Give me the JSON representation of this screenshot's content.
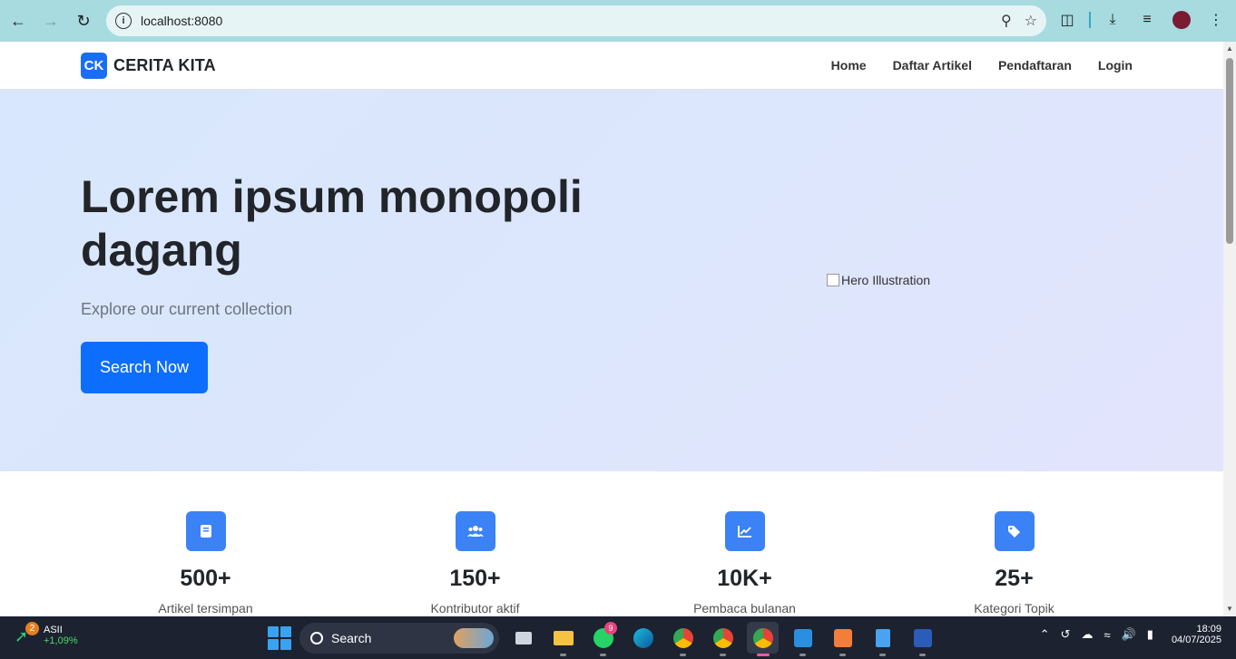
{
  "browser": {
    "url": "localhost:8080"
  },
  "site": {
    "brand_logo": "CK",
    "brand_name": "CERITA KITA",
    "menu": [
      {
        "label": "Home"
      },
      {
        "label": "Daftar Artikel"
      },
      {
        "label": "Pendaftaran"
      },
      {
        "label": "Login"
      }
    ]
  },
  "hero": {
    "title": "Lorem ipsum monopoli dagang",
    "subtitle": "Explore our current collection",
    "cta": "Search Now",
    "image_alt": "Hero Illustration"
  },
  "stats": [
    {
      "icon": "book-icon",
      "value": "500+",
      "label": "Artikel tersimpan"
    },
    {
      "icon": "users-icon",
      "value": "150+",
      "label": "Kontributor aktif"
    },
    {
      "icon": "chart-line-icon",
      "value": "10K+",
      "label": "Pembaca bulanan"
    },
    {
      "icon": "tags-icon",
      "value": "25+",
      "label": "Kategori Topik"
    }
  ],
  "taskbar": {
    "widget_badge": "2",
    "widget_title": "ASII",
    "widget_change": "+1,09%",
    "search_label": "Search",
    "whatsapp_badge": "9",
    "time": "18:09",
    "date": "04/07/2025"
  },
  "colors": {
    "accent": "#0d6efd",
    "stat_icon_bg": "#3b82f6",
    "chrome_bg": "#a7dbe0"
  }
}
